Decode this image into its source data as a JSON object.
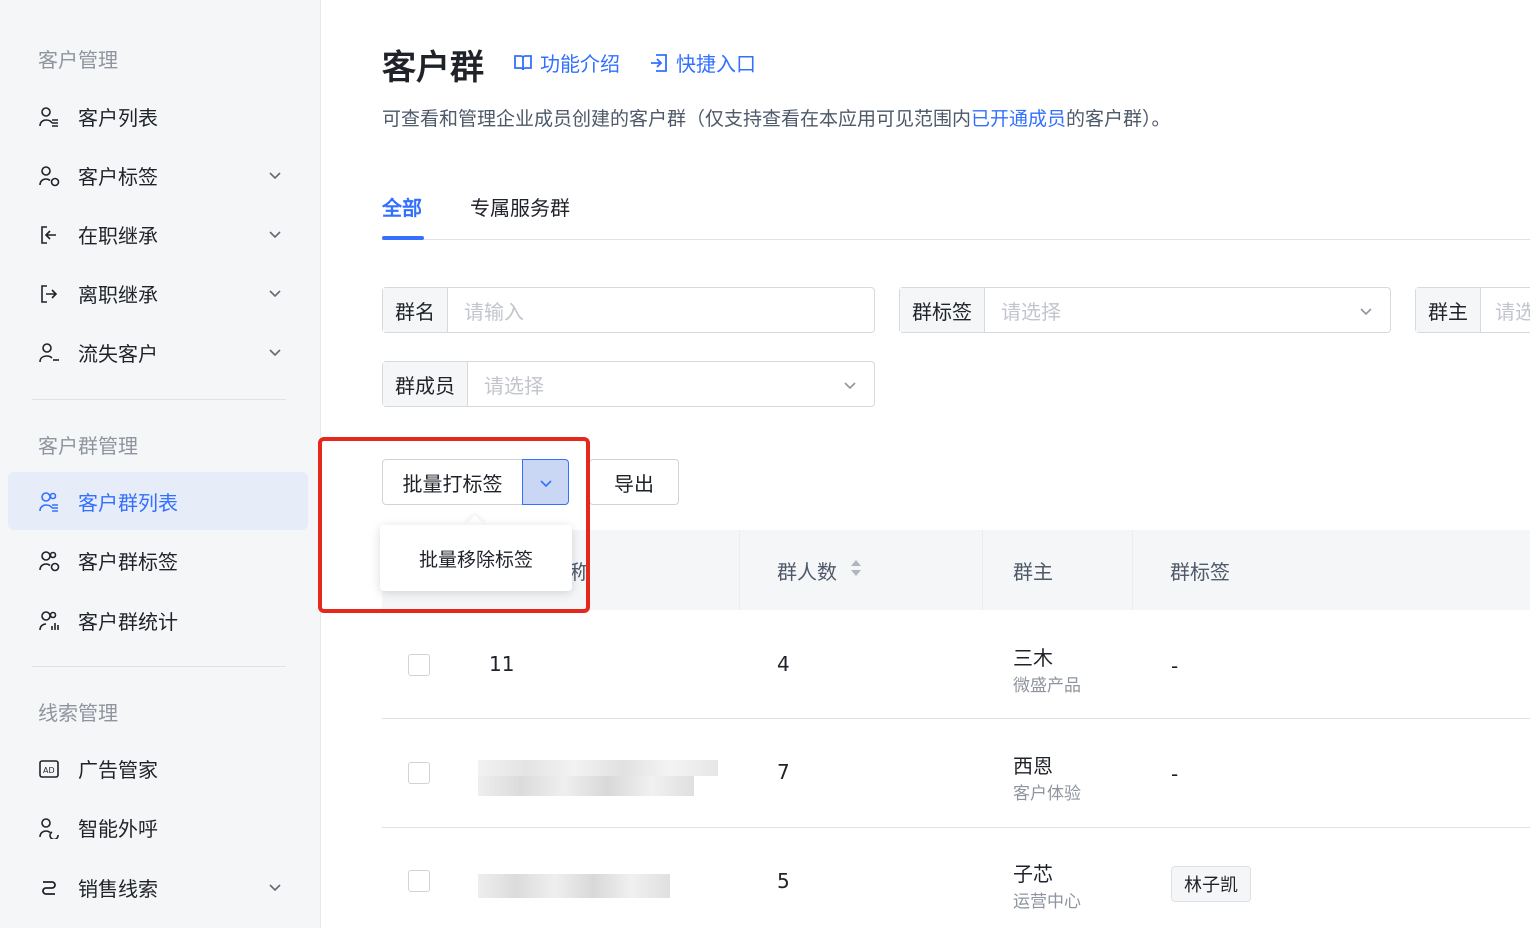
{
  "sidebar": {
    "group1": "客户管理",
    "group2": "客户群管理",
    "group3": "线索管理",
    "items": [
      {
        "label": "客户列表"
      },
      {
        "label": "客户标签"
      },
      {
        "label": "在职继承"
      },
      {
        "label": "离职继承"
      },
      {
        "label": "流失客户"
      },
      {
        "label": "客户群列表"
      },
      {
        "label": "客户群标签"
      },
      {
        "label": "客户群统计"
      },
      {
        "label": "广告管家"
      },
      {
        "label": "智能外呼"
      },
      {
        "label": "销售线索"
      }
    ],
    "active_item": "客户群列表"
  },
  "header": {
    "title": "客户群",
    "intro_link": "功能介绍",
    "shortcut_link": "快捷入口",
    "desc_prefix": "可查看和管理企业成员创建的客户群（仅支持查看在本应用可见范围内",
    "desc_link": "已开通成员",
    "desc_suffix": "的客户群）。"
  },
  "tabs": [
    {
      "label": "全部",
      "active": true
    },
    {
      "label": "专属服务群",
      "active": false
    }
  ],
  "filters": {
    "name_label": "群名",
    "name_placeholder": "请输入",
    "tag_label": "群标签",
    "tag_placeholder": "请选择",
    "owner_label": "群主",
    "owner_placeholder": "请选",
    "member_label": "群成员",
    "member_placeholder": "请选择"
  },
  "actions": {
    "batch_tag": "批量打标签",
    "export": "导出",
    "dropdown_item": "批量移除标签"
  },
  "table": {
    "columns": {
      "name_partial": "称",
      "count": "群人数",
      "owner": "群主",
      "tags": "群标签"
    },
    "rows": [
      {
        "name": "11",
        "count": "4",
        "owner": "三木",
        "dept": "微盛产品",
        "tags": "-"
      },
      {
        "name": "",
        "count": "7",
        "owner": "西恩",
        "dept": "客户体验",
        "tags": "-"
      },
      {
        "name": "",
        "count": "5",
        "owner": "子芯",
        "dept": "运营中心",
        "tags": "林子凯"
      }
    ]
  },
  "colors": {
    "accent": "#3370ff",
    "highlight": "#e5271c"
  }
}
